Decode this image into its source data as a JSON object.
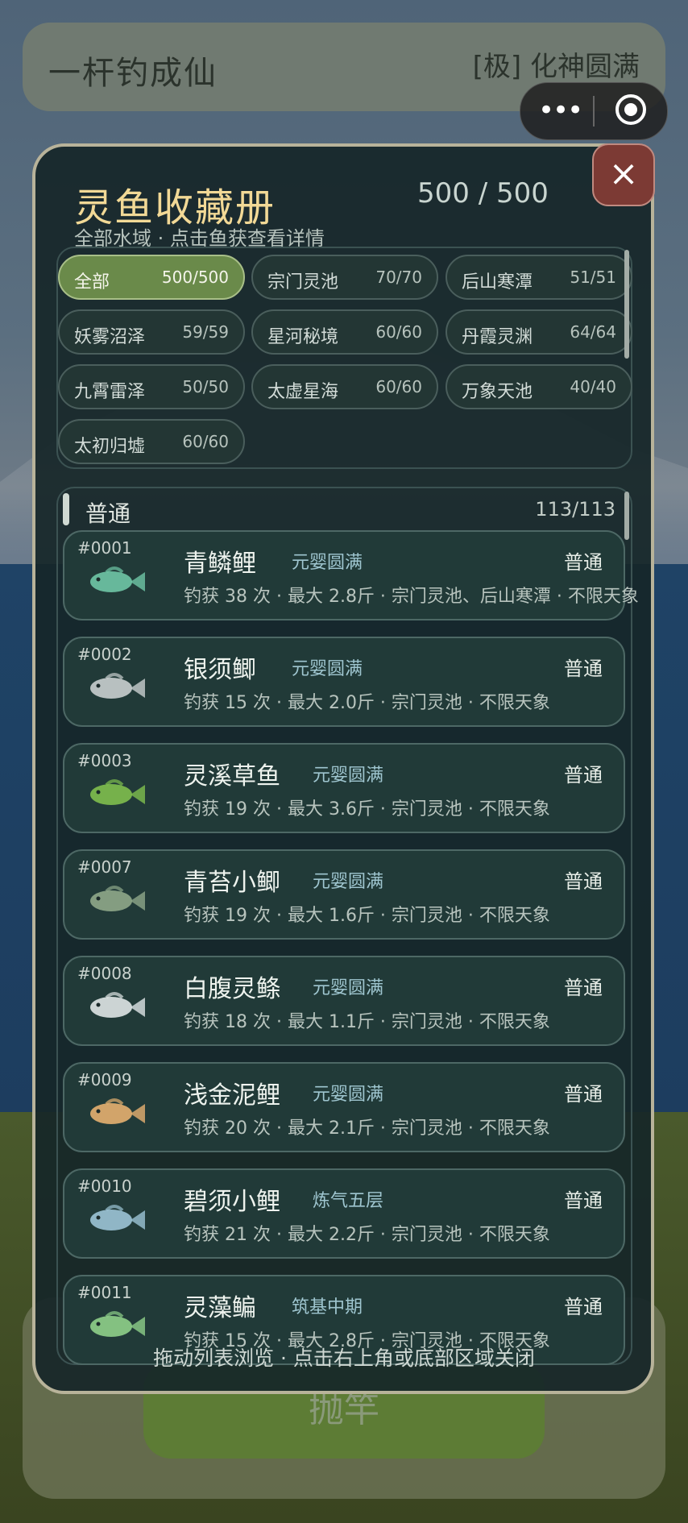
{
  "app": {
    "title": "一杆钓成仙",
    "realm": "[极] 化神圆满"
  },
  "cast_label": "抛竿",
  "panel": {
    "title": "灵鱼收藏册",
    "count": "500 / 500",
    "subtitle": "全部水域 · 点击鱼获查看详情",
    "close_label": "×",
    "hint": "拖动列表浏览 · 点击右上角或底部区域关闭"
  },
  "filters": [
    {
      "name": "全部",
      "count": "500/500",
      "active": true
    },
    {
      "name": "宗门灵池",
      "count": "70/70"
    },
    {
      "name": "后山寒潭",
      "count": "51/51"
    },
    {
      "name": "妖雾沼泽",
      "count": "59/59"
    },
    {
      "name": "星河秘境",
      "count": "60/60"
    },
    {
      "name": "丹霞灵渊",
      "count": "64/64"
    },
    {
      "name": "九霄雷泽",
      "count": "50/50"
    },
    {
      "name": "太虚星海",
      "count": "60/60"
    },
    {
      "name": "万象天池",
      "count": "40/40"
    },
    {
      "name": "太初归墟",
      "count": "60/60"
    }
  ],
  "section": {
    "title": "普通",
    "count": "113/113"
  },
  "fish": [
    {
      "id": "#0001",
      "name": "青鳞鲤",
      "realm": "元婴圆满",
      "rarity": "普通",
      "meta": "钓获 38 次 · 最大 2.8斤 · 宗门灵池、后山寒潭 · 不限天象",
      "color": "#6fc7a6"
    },
    {
      "id": "#0002",
      "name": "银须鲫",
      "realm": "元婴圆满",
      "rarity": "普通",
      "meta": "钓获 15 次 · 最大 2.0斤 · 宗门灵池 · 不限天象",
      "color": "#c9cfcf"
    },
    {
      "id": "#0003",
      "name": "灵溪草鱼",
      "realm": "元婴圆满",
      "rarity": "普通",
      "meta": "钓获 19 次 · 最大 3.6斤 · 宗门灵池 · 不限天象",
      "color": "#7fbf4e"
    },
    {
      "id": "#0007",
      "name": "青苔小鲫",
      "realm": "元婴圆满",
      "rarity": "普通",
      "meta": "钓获 19 次 · 最大 1.6斤 · 宗门灵池 · 不限天象",
      "color": "#8fa88a"
    },
    {
      "id": "#0008",
      "name": "白腹灵鲦",
      "realm": "元婴圆满",
      "rarity": "普通",
      "meta": "钓获 18 次 · 最大 1.1斤 · 宗门灵池 · 不限天象",
      "color": "#dfe5e6"
    },
    {
      "id": "#0009",
      "name": "浅金泥鲤",
      "realm": "元婴圆满",
      "rarity": "普通",
      "meta": "钓获 20 次 · 最大 2.1斤 · 宗门灵池 · 不限天象",
      "color": "#e6b070"
    },
    {
      "id": "#0010",
      "name": "碧须小鲤",
      "realm": "炼气五层",
      "rarity": "普通",
      "meta": "钓获 21 次 · 最大 2.2斤 · 宗门灵池 · 不限天象",
      "color": "#9cc4d6"
    },
    {
      "id": "#0011",
      "name": "灵藻鳊",
      "realm": "筑基中期",
      "rarity": "普通",
      "meta": "钓获 15 次 · 最大 2.8斤 · 宗门灵池 · 不限天象",
      "color": "#8fd08a"
    }
  ]
}
